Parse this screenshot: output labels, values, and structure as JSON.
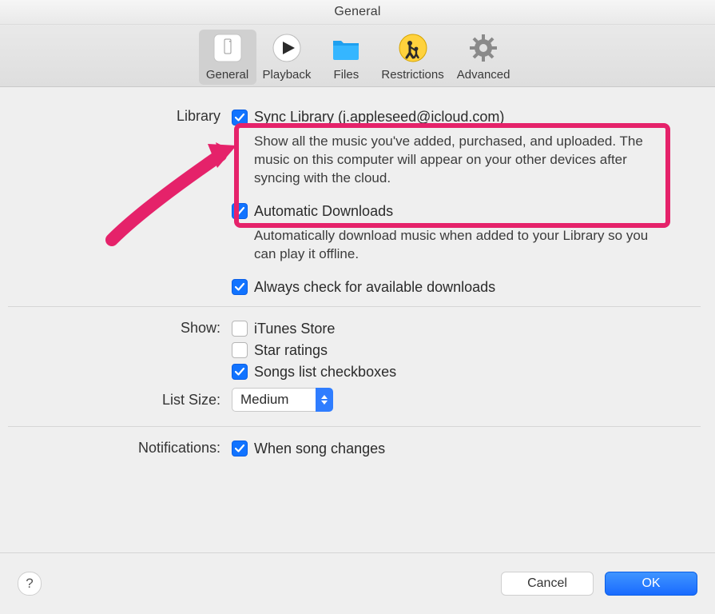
{
  "title": "General",
  "toolbar": {
    "items": [
      {
        "label": "General",
        "icon": "general-prefs-icon"
      },
      {
        "label": "Playback",
        "icon": "play-icon"
      },
      {
        "label": "Files",
        "icon": "folder-icon"
      },
      {
        "label": "Restrictions",
        "icon": "restrictions-icon"
      },
      {
        "label": "Advanced",
        "icon": "gear-icon"
      }
    ]
  },
  "sections": {
    "library_label": "Library",
    "show_label": "Show:",
    "list_size_label": "List Size:",
    "notifications_label": "Notifications:"
  },
  "library": {
    "sync": {
      "label": "Sync Library (j.appleseed@icloud.com)",
      "checked": true,
      "desc": "Show all the music you've added, purchased, and uploaded. The music on this computer will appear on your other devices after syncing with the cloud."
    },
    "auto_downloads": {
      "label": "Automatic Downloads",
      "checked": true,
      "desc": "Automatically download music when added to your Library so you can play it offline."
    },
    "always_check": {
      "label": "Always check for available downloads",
      "checked": true
    }
  },
  "show": {
    "itunes_store": {
      "label": "iTunes Store",
      "checked": false
    },
    "star_ratings": {
      "label": "Star ratings",
      "checked": false
    },
    "songs_list_checkboxes": {
      "label": "Songs list checkboxes",
      "checked": true
    }
  },
  "list_size": {
    "value": "Medium"
  },
  "notifications": {
    "when_song_changes": {
      "label": "When song changes",
      "checked": true
    }
  },
  "footer": {
    "help_label": "?",
    "cancel_label": "Cancel",
    "ok_label": "OK"
  },
  "annotation": {
    "present": true,
    "target": "sync-library-checkbox"
  }
}
